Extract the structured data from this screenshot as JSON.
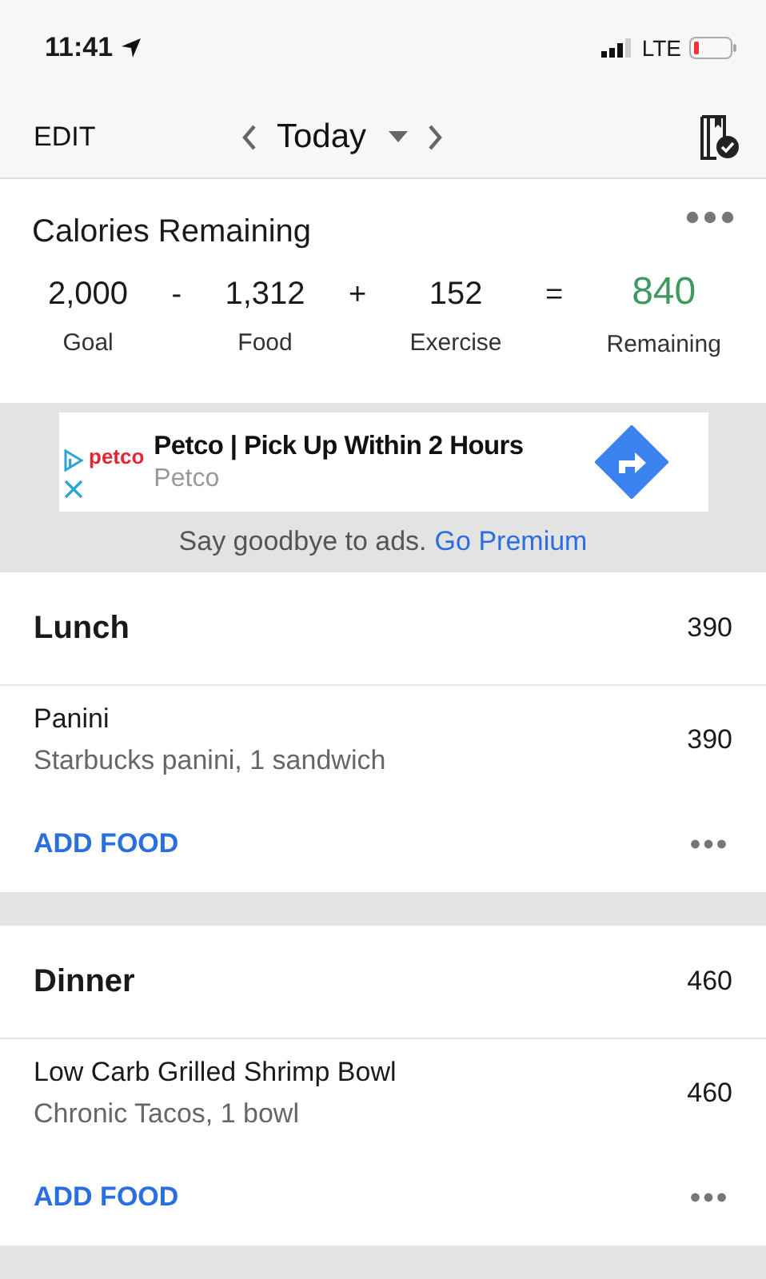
{
  "status_bar": {
    "time": "11:41",
    "network": "LTE"
  },
  "nav": {
    "edit": "EDIT",
    "date": "Today"
  },
  "summary": {
    "title": "Calories Remaining",
    "items": [
      {
        "value": "2,000",
        "label": "Goal",
        "kind": "plain"
      },
      {
        "value": "-",
        "kind": "operator"
      },
      {
        "value": "1,312",
        "label": "Food",
        "kind": "plain"
      },
      {
        "value": "+",
        "kind": "operator"
      },
      {
        "value": "152",
        "label": "Exercise",
        "kind": "plain"
      },
      {
        "value": "=",
        "kind": "operator"
      },
      {
        "value": "840",
        "label": "Remaining",
        "kind": "result"
      }
    ]
  },
  "ad": {
    "logo": "petco",
    "headline": "Petco | Pick Up Within 2 Hours",
    "advertiser": "Petco",
    "notice": "Say goodbye to ads.",
    "link": "Go Premium"
  },
  "meals": [
    {
      "name": "Lunch",
      "calories": "390",
      "foods": [
        {
          "name": "Panini",
          "detail": "Starbucks panini, 1 sandwich",
          "calories": "390"
        }
      ],
      "action": "ADD FOOD"
    },
    {
      "name": "Dinner",
      "calories": "460",
      "foods": [
        {
          "name": "Low Carb Grilled Shrimp Bowl",
          "detail": "Chronic Tacos, 1 bowl",
          "calories": "460"
        }
      ],
      "action": "ADD FOOD"
    }
  ]
}
